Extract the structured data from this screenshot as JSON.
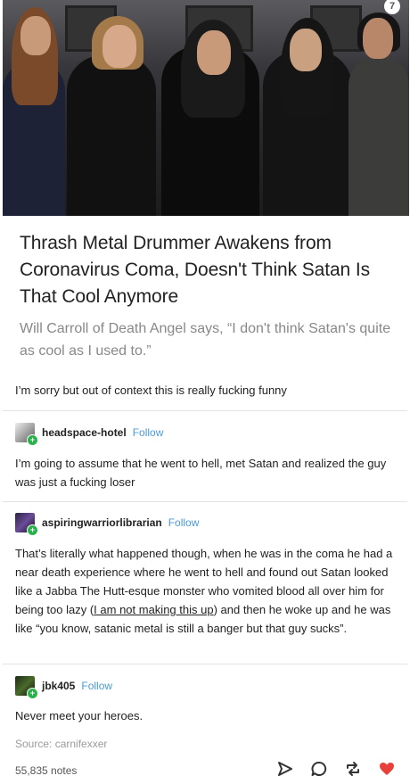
{
  "article": {
    "title": "Thrash Metal Drummer Awakens from Coronavirus Coma, Doesn't Think Satan Is That Cool Anymore",
    "subtitle": "Will Carroll of Death Angel says, “I don't think Satan's quite as cool as I used to.”"
  },
  "op_comment": "I’m sorry but out of context this is really fucking funny",
  "reblogs": [
    {
      "username": "headspace-hotel",
      "follow_label": "Follow",
      "text": "I’m going to assume that he went to hell, met Satan and realized the guy was just a fucking loser"
    },
    {
      "username": "aspiringwarriorlibrarian",
      "follow_label": "Follow",
      "text_before": "That’s literally what happened though, when he was in the coma he had a near death experience where he went to hell and found out Satan looked like a Jabba The Hutt-esque monster who vomited blood all over him for being too lazy (",
      "link_text": "I am not making this up",
      "text_after": ") and then he woke up and he was like “you know, satanic metal is still a banger but that guy sucks”."
    },
    {
      "username": "jbk405",
      "follow_label": "Follow",
      "text": "Never meet your heroes."
    }
  ],
  "source": "Source: carnifexxer",
  "notes": "55,835 notes",
  "icons": [
    "share-icon",
    "reply-icon",
    "reblog-icon",
    "like-icon"
  ],
  "colors": {
    "follow": "#4a9bd8",
    "like": "#e8413b",
    "avatar_plus": "#2ab24a"
  }
}
